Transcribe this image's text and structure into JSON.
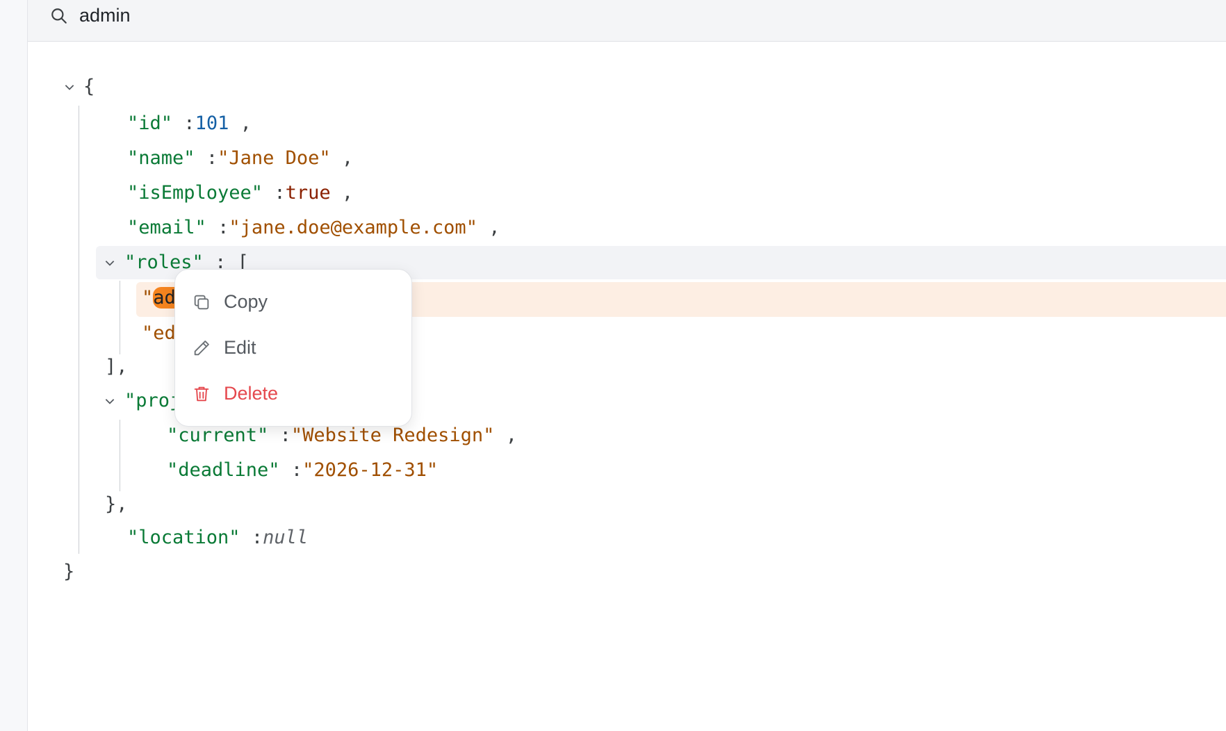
{
  "search": {
    "value": "admin"
  },
  "json": {
    "open_brace": "{",
    "close_brace": "}",
    "id": {
      "key": "\"id\"",
      "value": "101"
    },
    "name": {
      "key": "\"name\"",
      "value": "\"Jane Doe\""
    },
    "isEmployee": {
      "key": "\"isEmployee\"",
      "value": "true"
    },
    "email": {
      "key": "\"email\"",
      "value": "\"jane.doe@example.com\""
    },
    "roles": {
      "key": "\"roles\"",
      "open": "[",
      "close": "],",
      "item1_quote": "\"",
      "item1_match": "ad",
      "item2_partial": "\"ed"
    },
    "projects": {
      "key_partial": "\"proj",
      "close": "},",
      "current": {
        "key": "\"current\"",
        "value": "\"Website Redesign\""
      },
      "deadline": {
        "key": "\"deadline\"",
        "value": "\"2026-12-31\""
      }
    },
    "location": {
      "key": "\"location\"",
      "value": "null"
    },
    "colon": ":",
    "comma": ","
  },
  "context_menu": {
    "items": [
      {
        "label": "Copy",
        "icon": "copy-icon"
      },
      {
        "label": "Edit",
        "icon": "pencil-icon"
      },
      {
        "label": "Delete",
        "icon": "trash-icon",
        "color": "#e5484d"
      }
    ]
  },
  "colors": {
    "key": "#0a7a36",
    "string": "#a04f00",
    "number": "#1560a5",
    "boolean": "#8a2000",
    "match_highlight": "#f5841f",
    "danger": "#e5484d"
  }
}
